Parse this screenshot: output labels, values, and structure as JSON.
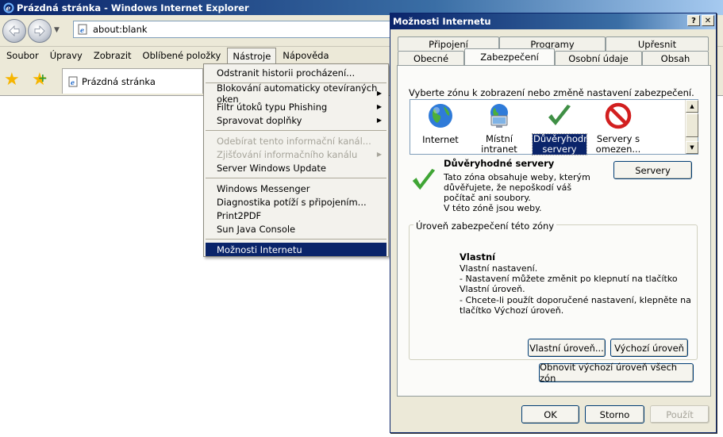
{
  "ie": {
    "title": "Prázdná stránka - Windows Internet Explorer",
    "address": "about:blank",
    "tab_title": "Prázdná stránka",
    "menubar": [
      "Soubor",
      "Úpravy",
      "Zobrazit",
      "Oblíbené položky",
      "Nástroje",
      "Nápověda"
    ]
  },
  "tools_menu": {
    "items": [
      {
        "label": "Odstranit historii procházení..."
      },
      {
        "label": "Blokování automaticky otevíraných oken"
      },
      {
        "label": "Filtr útoků typu Phishing"
      },
      {
        "label": "Spravovat doplňky"
      },
      {
        "label": "Odebírat tento informační kanál..."
      },
      {
        "label": "Zjišťování informačního kanálu"
      },
      {
        "label": "Server Windows Update"
      },
      {
        "label": "Windows Messenger"
      },
      {
        "label": "Diagnostika potíží s připojením..."
      },
      {
        "label": "Print2PDF"
      },
      {
        "label": "Sun Java Console"
      },
      {
        "label": "Možnosti Internetu"
      }
    ]
  },
  "dialog": {
    "title": "Možnosti Internetu",
    "help_glyph": "?",
    "close_glyph": "✕",
    "tabs_top": [
      "Připojení",
      "Programy",
      "Upřesnit"
    ],
    "tabs_bottom": [
      "Obecné",
      "Zabezpečení",
      "Osobní údaje",
      "Obsah"
    ],
    "zone_prompt": "Vyberte zónu k zobrazení nebo změně nastavení zabezpečení.",
    "zones": [
      {
        "label": "Internet",
        "icon": "globe-icon"
      },
      {
        "label": "Místní intranet",
        "icon": "computer-globe-icon"
      },
      {
        "label": "Důvěryhodné servery",
        "icon": "checkmark-icon"
      },
      {
        "label": "Servery s omezen...",
        "icon": "restricted-icon"
      }
    ],
    "selected_zone_name": "Důvěryhodné servery",
    "selected_zone_desc": "Tato zóna obsahuje weby, kterým důvěřujete, že nepoškodí váš počítač ani soubory.\nV této zóně jsou weby.",
    "servers_button": "Servery",
    "group_title": "Úroveň zabezpečení této zóny",
    "level_name": "Vlastní",
    "level_desc": "Vlastní nastavení.\n- Nastavení můžete změnit po klepnutí na tlačítko Vlastní úroveň.\n- Chcete-li použít doporučené nastavení, klepněte na tlačítko Výchozí úroveň.",
    "custom_level_button": "Vlastní úroveň...",
    "default_level_button": "Výchozí úroveň",
    "reset_all_button": "Obnovit výchozí úroveň všech zón",
    "ok_button": "OK",
    "cancel_button": "Storno",
    "apply_button": "Použít"
  },
  "colors": {
    "titlebar": "#0a246a",
    "selection": "#0a246a",
    "check_green": "#3fa535",
    "restricted_red": "#d21f1f"
  }
}
